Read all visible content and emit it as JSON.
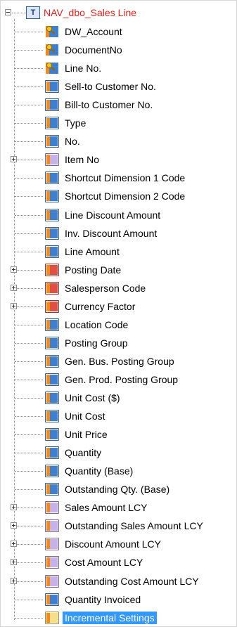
{
  "tree": {
    "root": {
      "label": "NAV_dbo_Sales Line",
      "icon": "table-icon",
      "icon_glyph": "T"
    },
    "items": [
      {
        "label": "DW_Account",
        "icon": "key-column-icon",
        "style": "key",
        "expander": null
      },
      {
        "label": "DocumentNo",
        "icon": "key-column-icon",
        "style": "key",
        "expander": null
      },
      {
        "label": "Line No.",
        "icon": "key-column-icon",
        "style": "key",
        "expander": null
      },
      {
        "label": "Sell-to Customer No.",
        "icon": "column-icon",
        "style": "blue",
        "expander": null
      },
      {
        "label": "Bill-to Customer No.",
        "icon": "column-icon",
        "style": "blue",
        "expander": null
      },
      {
        "label": "Type",
        "icon": "column-icon",
        "style": "blue",
        "expander": null
      },
      {
        "label": "No.",
        "icon": "column-icon",
        "style": "blue",
        "expander": null
      },
      {
        "label": "Item No",
        "icon": "reference-column-icon",
        "style": "purple",
        "expander": "plus"
      },
      {
        "label": "Shortcut Dimension 1 Code",
        "icon": "column-icon",
        "style": "blue",
        "expander": null
      },
      {
        "label": "Shortcut Dimension 2 Code",
        "icon": "column-icon",
        "style": "blue",
        "expander": null
      },
      {
        "label": "Line Discount Amount",
        "icon": "column-icon",
        "style": "blue",
        "expander": null
      },
      {
        "label": "Inv. Discount Amount",
        "icon": "column-icon",
        "style": "blue",
        "expander": null
      },
      {
        "label": "Line Amount",
        "icon": "column-icon",
        "style": "blue",
        "expander": null
      },
      {
        "label": "Posting Date",
        "icon": "lookup-column-icon",
        "style": "red",
        "expander": "plus"
      },
      {
        "label": "Salesperson Code",
        "icon": "lookup-column-icon",
        "style": "red",
        "expander": "plus"
      },
      {
        "label": "Currency Factor",
        "icon": "lookup-column-icon",
        "style": "red",
        "expander": "plus"
      },
      {
        "label": "Location Code",
        "icon": "column-icon",
        "style": "blue",
        "expander": null
      },
      {
        "label": "Posting Group",
        "icon": "column-icon",
        "style": "blue",
        "expander": null
      },
      {
        "label": "Gen. Bus. Posting Group",
        "icon": "column-icon",
        "style": "blue",
        "expander": null
      },
      {
        "label": "Gen. Prod. Posting Group",
        "icon": "column-icon",
        "style": "blue",
        "expander": null
      },
      {
        "label": "Unit Cost ($)",
        "icon": "column-icon",
        "style": "blue",
        "expander": null
      },
      {
        "label": "Unit Cost",
        "icon": "column-icon",
        "style": "blue",
        "expander": null
      },
      {
        "label": "Unit Price",
        "icon": "column-icon",
        "style": "blue",
        "expander": null
      },
      {
        "label": "Quantity",
        "icon": "column-icon",
        "style": "blue",
        "expander": null
      },
      {
        "label": "Quantity (Base)",
        "icon": "column-icon",
        "style": "blue",
        "expander": null
      },
      {
        "label": "Outstanding Qty. (Base)",
        "icon": "column-icon",
        "style": "blue",
        "expander": null
      },
      {
        "label": "Sales Amount LCY",
        "icon": "reference-column-icon",
        "style": "purple",
        "expander": "plus"
      },
      {
        "label": "Outstanding Sales Amount LCY",
        "icon": "reference-column-icon",
        "style": "purple",
        "expander": "plus"
      },
      {
        "label": "Discount Amount LCY",
        "icon": "reference-column-icon",
        "style": "purple",
        "expander": "plus"
      },
      {
        "label": "Cost Amount LCY",
        "icon": "reference-column-icon",
        "style": "purple",
        "expander": "plus"
      },
      {
        "label": "Outstanding Cost Amount LCY",
        "icon": "reference-column-icon",
        "style": "purple",
        "expander": "plus"
      },
      {
        "label": "Quantity Invoiced",
        "icon": "column-icon",
        "style": "blue",
        "expander": null
      },
      {
        "label": "Incremental Settings",
        "icon": "settings-column-icon",
        "style": "yellow",
        "expander": null,
        "selected": true
      }
    ]
  },
  "colors": {
    "root_label": "#e0201c",
    "selection": "#3399ff",
    "column_blue": "#3f7fd0",
    "lookup_red": "#e04e44",
    "reference_purple": "#c6b2e8",
    "settings_yellow": "#f5df8a",
    "key_orange": "#f28a1a"
  }
}
